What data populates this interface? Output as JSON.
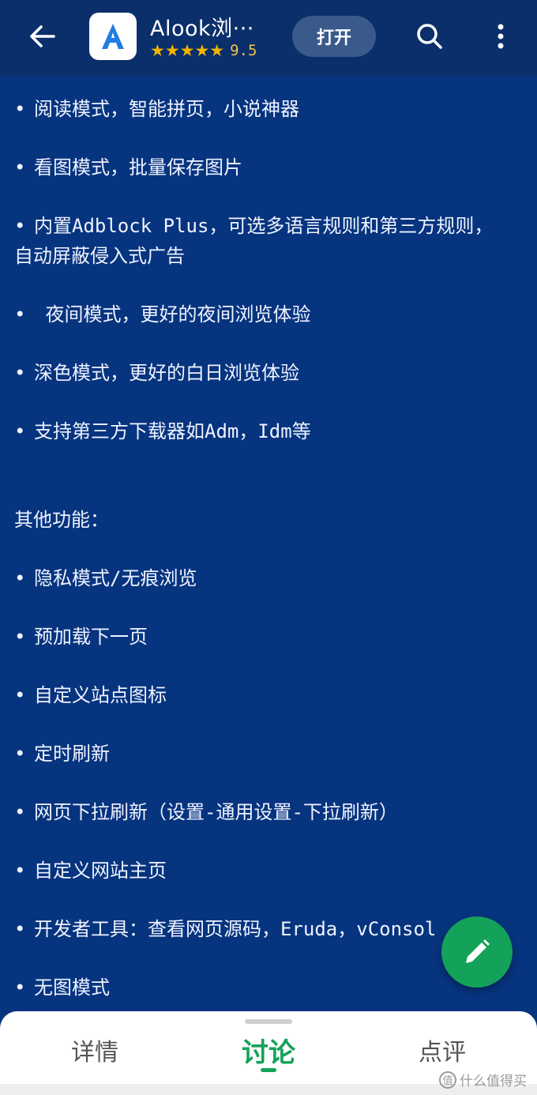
{
  "header": {
    "app_name": "Alook浏···",
    "app_icon_letter": "A",
    "stars": "★★★★★",
    "rating": "9.5",
    "open_label": "打开"
  },
  "content": {
    "bullet": "•",
    "lines": [
      {
        "bullet": true,
        "text": "阅读模式，智能拼页，小说神器"
      },
      {
        "bullet": true,
        "text": "看图模式，批量保存图片"
      },
      {
        "bullet": true,
        "text": "内置Adblock Plus，可选多语言规则和第三方规则，"
      },
      {
        "bullet": false,
        "text": "自动屏蔽侵入式广告"
      },
      {
        "bullet": true,
        "text": " 夜间模式，更好的夜间浏览体验"
      },
      {
        "bullet": true,
        "text": "深色模式，更好的白日浏览体验"
      },
      {
        "bullet": true,
        "text": "支持第三方下载器如Adm，Idm等"
      },
      {
        "bullet": false,
        "text": "其他功能："
      },
      {
        "bullet": true,
        "text": "隐私模式/无痕浏览"
      },
      {
        "bullet": true,
        "text": "预加载下一页"
      },
      {
        "bullet": true,
        "text": "自定义站点图标"
      },
      {
        "bullet": true,
        "text": "定时刷新"
      },
      {
        "bullet": true,
        "text": "网页下拉刷新（设置-通用设置-下拉刷新）"
      },
      {
        "bullet": true,
        "text": "自定义网站主页"
      },
      {
        "bullet": true,
        "text": "开发者工具：查看网页源码，Eruda，vConsol"
      },
      {
        "bullet": true,
        "text": "无图模式"
      }
    ]
  },
  "tabs": [
    {
      "label": "详情",
      "active": false
    },
    {
      "label": "讨论",
      "active": true
    },
    {
      "label": "点评",
      "active": false
    }
  ],
  "watermark": {
    "badge": "值",
    "text": "什么值得买"
  },
  "colors": {
    "background": "#07347f",
    "header": "#0a2f6b",
    "accent_green": "#14a25a",
    "star": "#f5b400"
  },
  "icons": [
    "back-arrow-icon",
    "search-icon",
    "more-vert-icon",
    "edit-pencil-icon"
  ]
}
